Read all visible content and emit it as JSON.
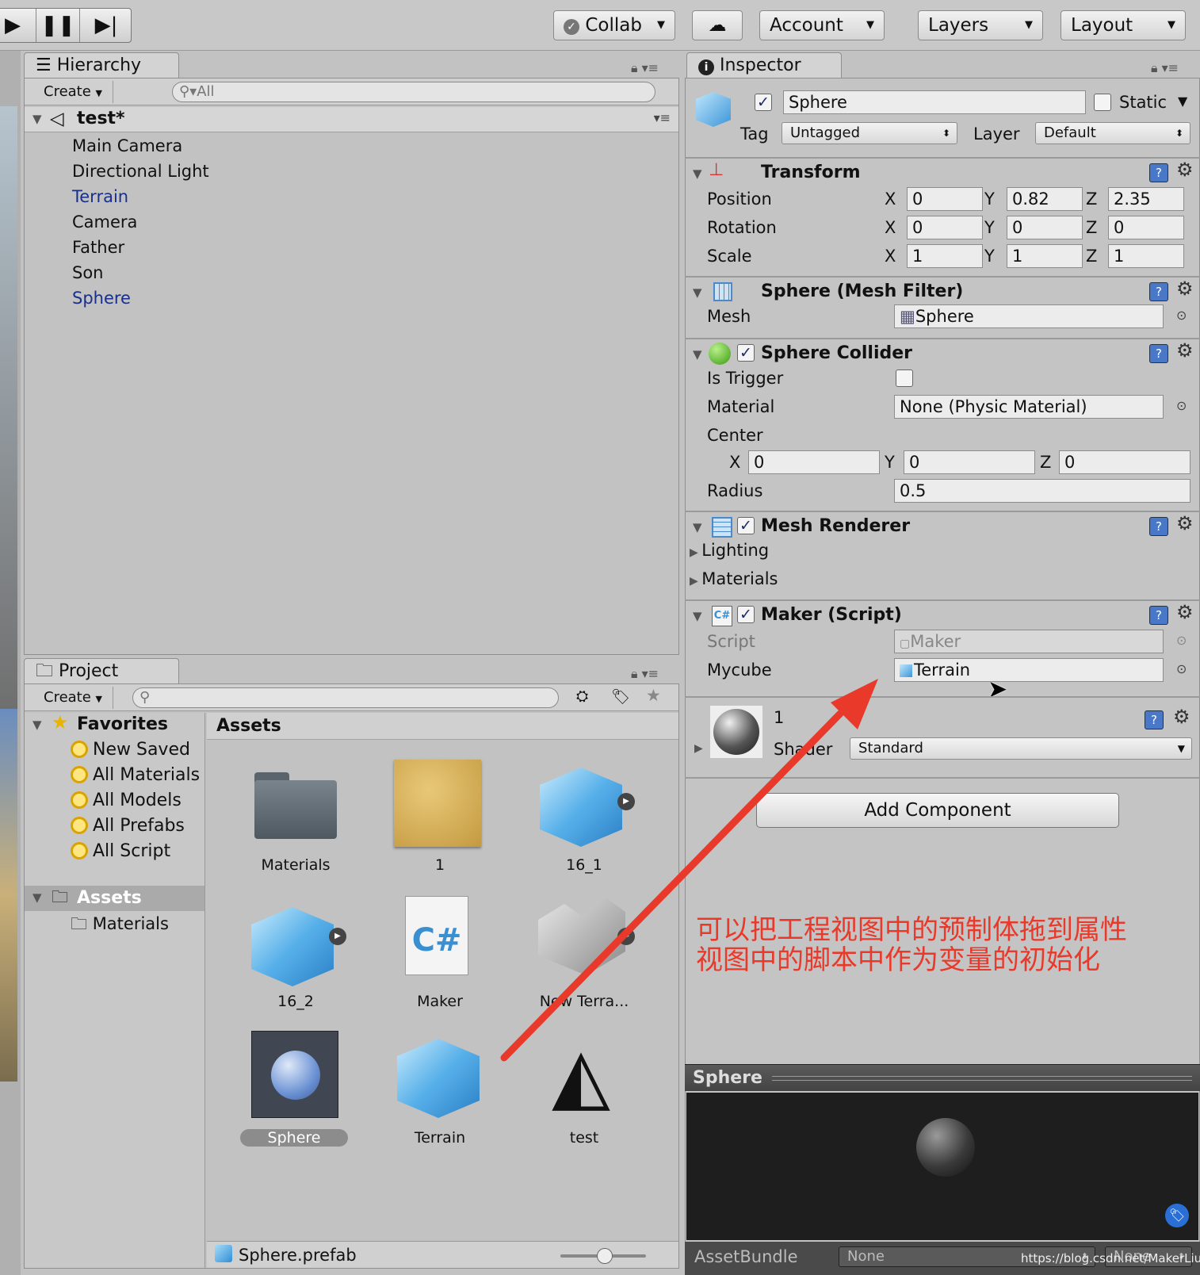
{
  "toolbar": {
    "play": "▶",
    "pause": "❚❚",
    "step": "▶|",
    "collab": "Collab",
    "cloud": "☁",
    "account": "Account",
    "layers": "Layers",
    "layout": "Layout"
  },
  "hierarchy": {
    "tab": "Hierarchy",
    "create": "Create",
    "search_placeholder": "All",
    "scene": "test*",
    "items": [
      {
        "label": "Main Camera",
        "color": "#111111"
      },
      {
        "label": "Directional Light",
        "color": "#111111"
      },
      {
        "label": "Terrain",
        "color": "#1a2f8a"
      },
      {
        "label": "Camera",
        "color": "#111111"
      },
      {
        "label": "Father",
        "color": "#111111"
      },
      {
        "label": "Son",
        "color": "#111111"
      },
      {
        "label": "Sphere",
        "color": "#1a2f8a"
      }
    ]
  },
  "project": {
    "tab": "Project",
    "create": "Create",
    "favorites": "Favorites",
    "fav_items": [
      "New Saved",
      "All Materials",
      "All Models",
      "All Prefabs",
      "All Script"
    ],
    "assets_root": "Assets",
    "assets_sub": "Materials",
    "assets_header": "Assets",
    "assets": [
      "Materials",
      "1",
      "16_1",
      "16_2",
      "Maker",
      "New Terra...",
      "Sphere",
      "Terrain",
      "test"
    ],
    "footer": "Sphere.prefab"
  },
  "inspector": {
    "tab": "Inspector",
    "object_name": "Sphere",
    "static_label": "Static",
    "tag_label": "Tag",
    "tag_value": "Untagged",
    "layer_label": "Layer",
    "layer_value": "Default",
    "transform": {
      "title": "Transform",
      "position": "Position",
      "rotation": "Rotation",
      "scale": "Scale",
      "pos": [
        "0",
        "0.82",
        "2.35"
      ],
      "rot": [
        "0",
        "0",
        "0"
      ],
      "scl": [
        "1",
        "1",
        "1"
      ],
      "x": "X",
      "y": "Y",
      "z": "Z"
    },
    "mesh_filter": {
      "title": "Sphere (Mesh Filter)",
      "mesh_label": "Mesh",
      "mesh_value": "Sphere"
    },
    "collider": {
      "title": "Sphere Collider",
      "is_trigger": "Is Trigger",
      "material_label": "Material",
      "material_value": "None (Physic Material)",
      "center_label": "Center",
      "center": [
        "0",
        "0",
        "0"
      ],
      "radius_label": "Radius",
      "radius_value": "0.5"
    },
    "renderer": {
      "title": "Mesh Renderer",
      "lighting": "Lighting",
      "materials": "Materials"
    },
    "script": {
      "title": "Maker (Script)",
      "script_label": "Script",
      "script_value": "Maker",
      "mycube_label": "Mycube",
      "mycube_value": "Terrain"
    },
    "material": {
      "name": "1",
      "shader_label": "Shader",
      "shader_value": "Standard"
    },
    "add_component": "Add Component",
    "preview_title": "Sphere",
    "assetbundle_label": "AssetBundle",
    "assetbundle_value": "None",
    "assetbundle_variant": "None"
  },
  "annotation": {
    "line1": "可以把工程视图中的预制体拖到属性",
    "line2": "视图中的脚本中作为变量的初始化",
    "color": "#e8392a"
  },
  "watermark": "https://blog.csdn.net/MakerLiu"
}
